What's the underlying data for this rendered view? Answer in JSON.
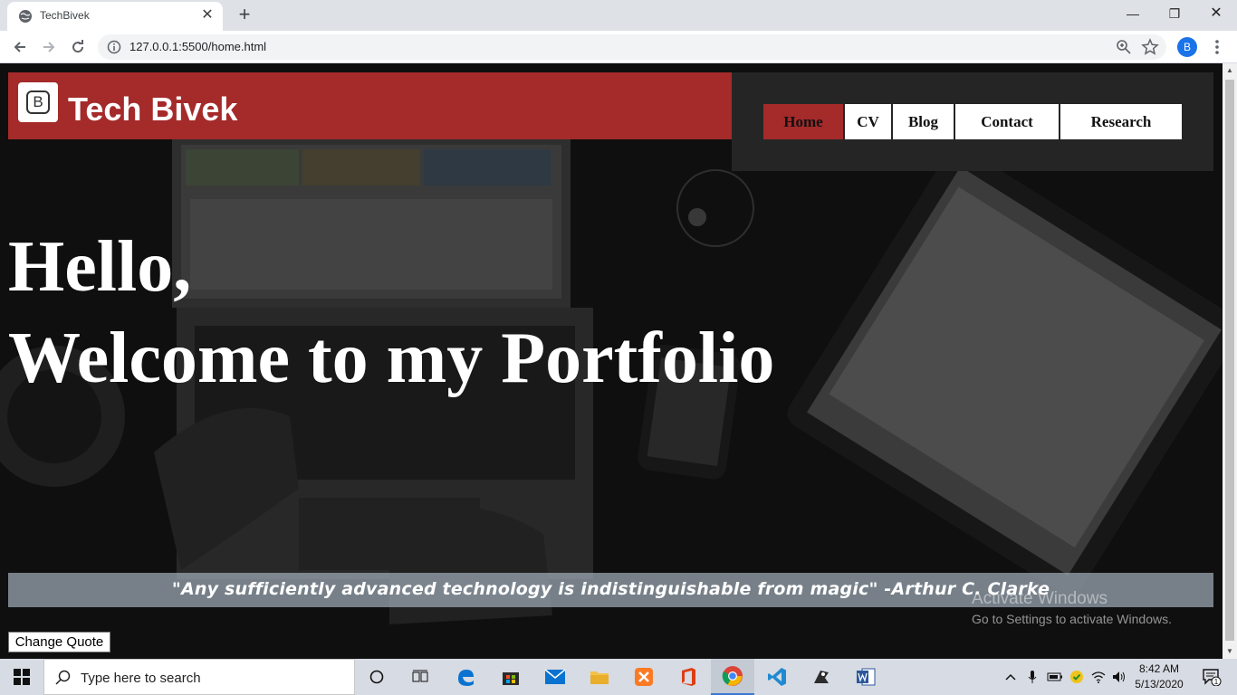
{
  "browser": {
    "tab_title": "TechBivek",
    "url": "127.0.0.1:5500/home.html",
    "profile_initial": "B"
  },
  "site": {
    "brand_logo_letter": "B",
    "brand_name": "Tech Bivek",
    "nav": [
      {
        "label": "Home",
        "active": true
      },
      {
        "label": "CV",
        "active": false
      },
      {
        "label": "Blog",
        "active": false
      },
      {
        "label": "Contact",
        "active": false
      },
      {
        "label": "Research",
        "active": false
      }
    ],
    "hero_line1": "Hello,",
    "hero_line2": "Welcome to my Portfolio",
    "quote": "\"Any sufficiently advanced technology is indistinguishable from magic\" -Arthur C. Clarke",
    "change_quote_label": "Change Quote"
  },
  "watermark": {
    "title": "Activate Windows",
    "subtitle": "Go to Settings to activate Windows."
  },
  "taskbar": {
    "search_placeholder": "Type here to search",
    "apps": [
      "cortana",
      "task-view",
      "edge",
      "store",
      "mail",
      "file-explorer",
      "xampp",
      "office",
      "chrome",
      "vscode",
      "git-bash",
      "word"
    ],
    "active_app": "chrome",
    "time": "8:42 AM",
    "date": "5/13/2020",
    "notification_count": "1"
  },
  "colors": {
    "brand_red": "#a52a2a",
    "nav_panel": "#262525",
    "quote_bar": "#a0acb8"
  }
}
